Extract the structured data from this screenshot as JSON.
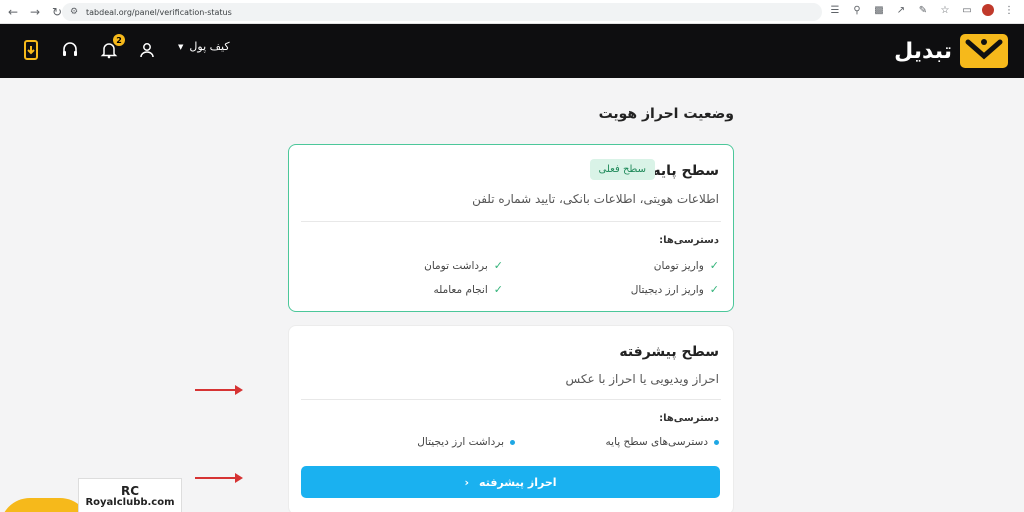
{
  "browser": {
    "url": "tabdeal.org/panel/verification-status"
  },
  "header": {
    "brand": "تبدیل",
    "wallet_label": "کیف پول",
    "notification_count": "2"
  },
  "page": {
    "title": "وضعیت احراز هویت"
  },
  "basic_level": {
    "title": "سطح پایه",
    "badge": "سطح فعلی",
    "description": "اطلاعات هویتی، اطلاعات بانکی، تایید شماره تلفن",
    "access_label": "دسترسی‌ها:",
    "permissions": [
      "واریز تومان",
      "برداشت تومان",
      "واریز ارز دیجیتال",
      "انجام معامله"
    ]
  },
  "advanced_level": {
    "title": "سطح پیشرفته",
    "description": "احراز ویدیویی یا احراز با عکس",
    "access_label": "دسترسی‌ها:",
    "permissions": [
      "دسترسی‌های سطح پایه",
      "برداشت ارز دیجیتال"
    ],
    "button_label": "احراز پیشرفته"
  },
  "watermark": {
    "logo": "RC",
    "text": "Royalclubb.com"
  },
  "colors": {
    "accent": "#1ab1f0",
    "brand_yellow": "#f6b91b",
    "success": "#34b37a",
    "header_bg": "#0e0e10"
  }
}
